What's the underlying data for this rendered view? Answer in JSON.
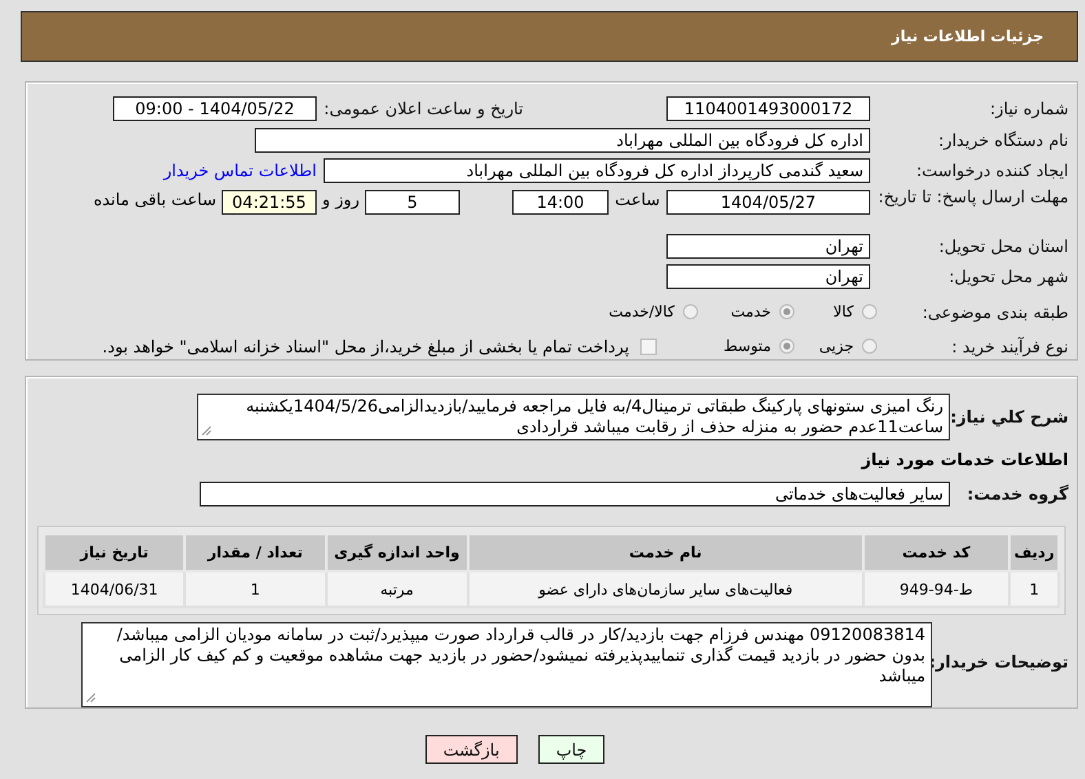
{
  "header": {
    "title": "جزئیات اطلاعات نیاز"
  },
  "details": {
    "need_number": {
      "label": "شماره نیاز:",
      "value": "1104001493000172"
    },
    "announce_date": {
      "label": "تاریخ و ساعت اعلان عمومی:",
      "value": "1404/05/22 - 09:00"
    },
    "buyer_org": {
      "label": "نام دستگاه خریدار:",
      "value": "اداره کل فرودگاه بین المللی مهراباد"
    },
    "requester": {
      "label": "ایجاد کننده درخواست:",
      "value": "سعید گندمی کارپرداز اداره کل فرودگاه بین المللی مهراباد",
      "link": "اطلاعات تماس خریدار"
    },
    "deadline": {
      "label": "مهلت ارسال پاسخ: تا تاریخ:",
      "date": "1404/05/27",
      "time_label": "ساعت",
      "time": "14:00",
      "days": "5",
      "days_label": "روز و",
      "remaining": "04:21:55",
      "remaining_label": "ساعت باقی مانده"
    },
    "province": {
      "label": "استان محل تحویل:",
      "value": "تهران"
    },
    "city": {
      "label": "شهر محل تحویل:",
      "value": "تهران"
    },
    "category": {
      "label": "طبقه بندی موضوعی:",
      "options": [
        {
          "label": "کالا",
          "selected": false
        },
        {
          "label": "خدمت",
          "selected": true
        },
        {
          "label": "کالا/خدمت",
          "selected": false
        }
      ]
    },
    "purchase_type": {
      "label": "نوع فرآیند خرید :",
      "options": [
        {
          "label": "جزیی",
          "selected": false
        },
        {
          "label": "متوسط",
          "selected": true
        }
      ],
      "payment": {
        "label": "پرداخت تمام یا بخشی از مبلغ خرید،از محل \"اسناد خزانه اسلامی\" خواهد بود.",
        "checked": false
      }
    }
  },
  "description": {
    "label": "شرح کلي نياز:",
    "value": "رنگ امیزی ستونهای پارکینگ طبقاتی ترمینال4/به فایل مراجعه فرمایید/بازدیدالزامی1404/5/26یکشنبه ساعت11عدم حضور به منزله حذف از رقابت میباشد قراردادی"
  },
  "services": {
    "title": "اطلاعات خدمات مورد نياز",
    "group_label": "گروه خدمت:",
    "group": "سایر فعالیت‌های خدماتی",
    "table": {
      "columns": [
        "ردیف",
        "کد خدمت",
        "نام خدمت",
        "واحد اندازه گیری",
        "تعداد / مقدار",
        "تاریخ نیاز"
      ],
      "rows": [
        [
          "1",
          "ط-94-949",
          "فعالیت‌های سایر سازمان‌های دارای عضو",
          "مرتبه",
          "1",
          "1404/06/31"
        ]
      ]
    }
  },
  "buyer_notes": {
    "label": "توضیحات خریدار:",
    "value": "09120083814 مهندس فرزام جهت بازدید/کار در قالب قرارداد صورت میپذیرد/ثبت در سامانه مودیان الزامی میباشد/بدون حضور در بازدید قیمت گذاری تنماییدپذیرفته نمیشود/حضور در بازدید جهت مشاهده موقعیت و کم کیف کار الزامی میباشد"
  },
  "buttons": [
    {
      "label": "چاپ",
      "kind": "print"
    },
    {
      "label": "بازگشت",
      "kind": "back"
    }
  ]
}
